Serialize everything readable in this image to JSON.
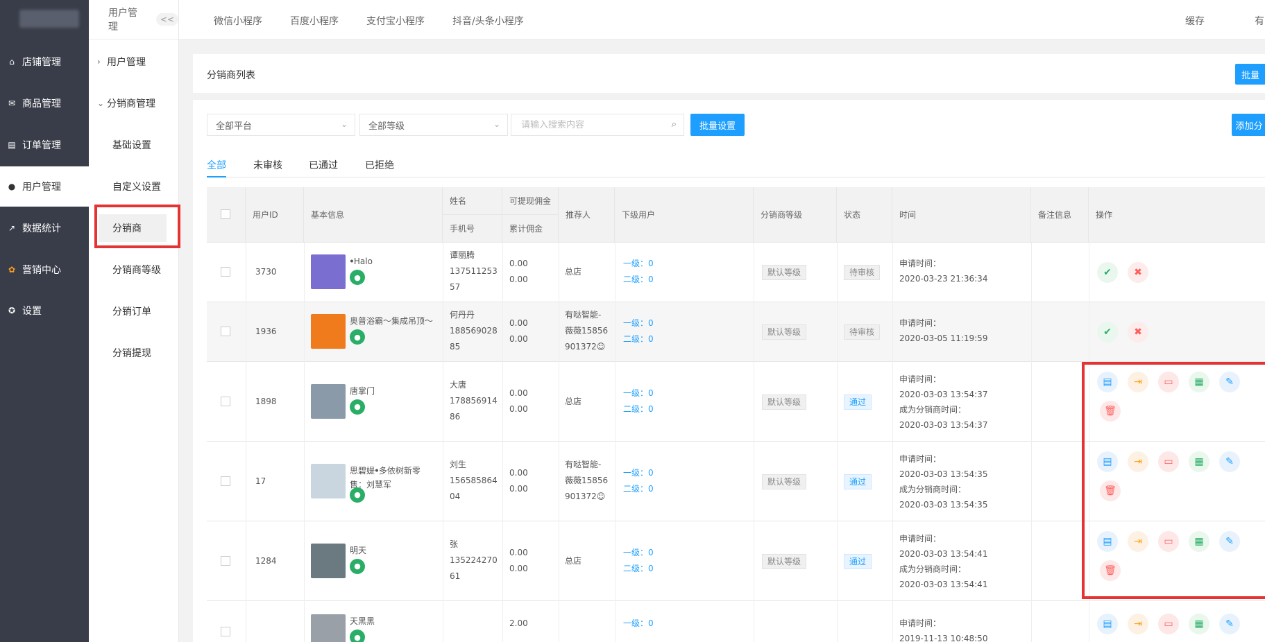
{
  "sidebar": {
    "items": [
      {
        "label": "店铺管理",
        "icon": "store-icon"
      },
      {
        "label": "商品管理",
        "icon": "goods-icon"
      },
      {
        "label": "订单管理",
        "icon": "order-icon"
      },
      {
        "label": "用户管理",
        "icon": "user-icon",
        "active": true
      },
      {
        "label": "数据统计",
        "icon": "chart-icon"
      },
      {
        "label": "营销中心",
        "icon": "marketing-icon"
      },
      {
        "label": "设置",
        "icon": "settings-icon"
      }
    ]
  },
  "subnav": {
    "title": "用户管理",
    "collapse": "<<",
    "items": [
      {
        "label": "用户管理"
      },
      {
        "label": "分销商管理"
      },
      {
        "label": "基础设置"
      },
      {
        "label": "自定义设置"
      },
      {
        "label": "分销商"
      },
      {
        "label": "分销商等级"
      },
      {
        "label": "分销订单"
      },
      {
        "label": "分销提现"
      }
    ]
  },
  "topbar": {
    "tabs": [
      "微信小程序",
      "百度小程序",
      "支付宝小程序",
      "抖音/头条小程序"
    ],
    "right": [
      "缓存",
      "有"
    ]
  },
  "panel": {
    "title": "分销商列表",
    "batch_btn": "批量",
    "add_btn": "添加分"
  },
  "filters": {
    "platform": "全部平台",
    "level": "全部等级",
    "search_placeholder": "请输入搜索内容",
    "batch_set": "批量设置"
  },
  "tabs": [
    "全部",
    "未审核",
    "已通过",
    "已拒绝"
  ],
  "table": {
    "headers": {
      "user_id": "用户ID",
      "basic": "基本信息",
      "name": "姓名",
      "phone": "手机号",
      "withdrawable": "可提现佣金",
      "total": "累计佣金",
      "referrer": "推荐人",
      "sub_users": "下级用户",
      "level": "分销商等级",
      "status": "状态",
      "time": "时间",
      "remark": "备注信息",
      "ops": "操作"
    },
    "rows": [
      {
        "id": "3730",
        "nick": "ꔷHalo",
        "nick2": "",
        "name": "谭丽腾",
        "phone1": "137511253",
        "phone2": "57",
        "w": "0.00",
        "t": "0.00",
        "ref1": "总店",
        "ref2": "",
        "ref3": "",
        "l1": "一级：0",
        "l2": "二级：0",
        "level": "默认等级",
        "status": "待审核",
        "t1": "申请时间：",
        "t2": "2020-03-23 21:36:34",
        "t3": "",
        "t4": ""
      },
      {
        "id": "1936",
        "nick": "奥普浴霸～集成吊顶～",
        "nick2": "",
        "name": "何丹丹",
        "phone1": "188569028",
        "phone2": "85",
        "w": "0.00",
        "t": "0.00",
        "ref1": "有哒智能-",
        "ref2": "薇薇15856",
        "ref3": "901372☺",
        "l1": "一级：0",
        "l2": "二级：0",
        "level": "默认等级",
        "status": "待审核",
        "t1": "申请时间：",
        "t2": "2020-03-05 11:19:59",
        "t3": "",
        "t4": ""
      },
      {
        "id": "1898",
        "nick": "唐掌门",
        "nick2": "",
        "name": "大唐",
        "phone1": "178856914",
        "phone2": "86",
        "w": "0.00",
        "t": "0.00",
        "ref1": "总店",
        "ref2": "",
        "ref3": "",
        "l1": "一级：0",
        "l2": "二级：0",
        "level": "默认等级",
        "status": "通过",
        "t1": "申请时间：",
        "t2": "2020-03-03 13:54:37",
        "t3": "成为分销商时间：",
        "t4": "2020-03-03 13:54:37"
      },
      {
        "id": "17",
        "nick": "思碧媞ꔷ多依树新零",
        "nick2": "售：刘慧军",
        "name": "刘生",
        "phone1": "156585864",
        "phone2": "04",
        "w": "0.00",
        "t": "0.00",
        "ref1": "有哒智能-",
        "ref2": "薇薇15856",
        "ref3": "901372☺",
        "l1": "一级：0",
        "l2": "二级：0",
        "level": "默认等级",
        "status": "通过",
        "t1": "申请时间：",
        "t2": "2020-03-03 13:54:35",
        "t3": "成为分销商时间：",
        "t4": "2020-03-03 13:54:35"
      },
      {
        "id": "1284",
        "nick": "明天",
        "nick2": "",
        "name": "张",
        "phone1": "135224270",
        "phone2": "61",
        "w": "0.00",
        "t": "0.00",
        "ref1": "总店",
        "ref2": "",
        "ref3": "",
        "l1": "一级：0",
        "l2": "二级：0",
        "level": "默认等级",
        "status": "通过",
        "t1": "申请时间：",
        "t2": "2020-03-03 13:54:41",
        "t3": "成为分销商时间：",
        "t4": "2020-03-03 13:54:41"
      },
      {
        "id": "",
        "nick": "天黑黑",
        "nick2": "",
        "name": "",
        "phone1": "",
        "phone2": "",
        "w": "2.00",
        "t": "",
        "ref1": "",
        "ref2": "",
        "ref3": "",
        "l1": "一级：0",
        "l2": "",
        "level": "",
        "status": "",
        "t1": "申请时间：",
        "t2": "2019-11-13 10:48:50",
        "t3": "",
        "t4": ""
      }
    ]
  },
  "colors": {
    "sidebar_bg": "#393d49",
    "accent": "#1e9fff",
    "highlight_box": "#e53333"
  }
}
